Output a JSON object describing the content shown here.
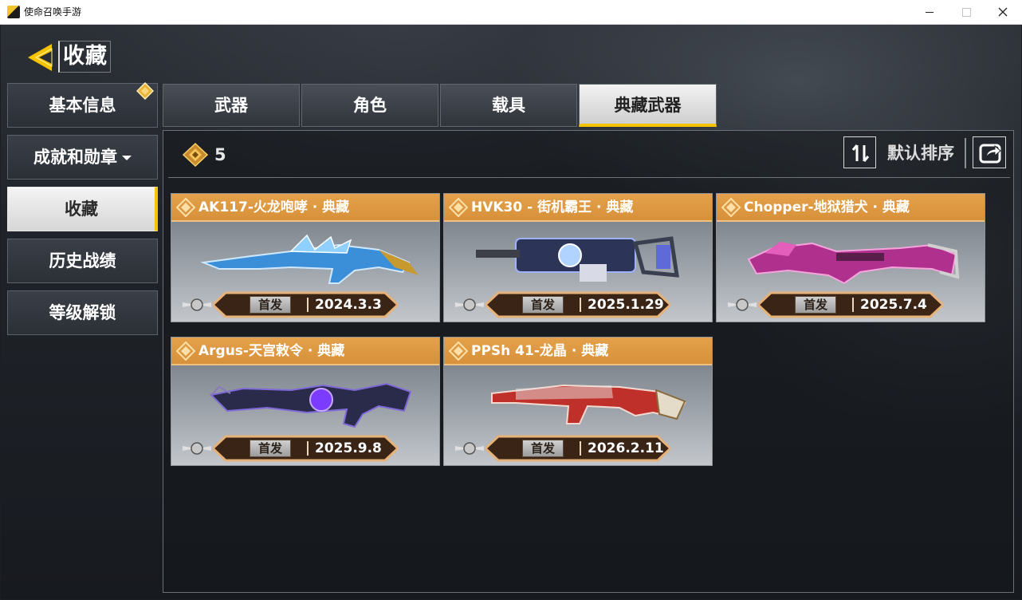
{
  "window": {
    "title": "使命召唤手游"
  },
  "header": {
    "title": "收藏"
  },
  "sidebar": {
    "items": [
      {
        "label": "基本信息"
      },
      {
        "label": "成就和勋章"
      },
      {
        "label": "收藏"
      },
      {
        "label": "历史战绩"
      },
      {
        "label": "等级解锁"
      }
    ]
  },
  "tabs": [
    {
      "label": "武器"
    },
    {
      "label": "角色"
    },
    {
      "label": "载具"
    },
    {
      "label": "典藏武器"
    }
  ],
  "toolbar": {
    "count": "5",
    "sort_label": "默认排序"
  },
  "cards": [
    {
      "name": "AK117-火龙咆哮 · 典藏",
      "tag": "首发",
      "date": "2024.3.3",
      "accent": "#4aa3e0"
    },
    {
      "name": "HVK30 - 街机霸王 · 典藏",
      "tag": "首发",
      "date": "2025.1.29",
      "accent": "#6a7fd6"
    },
    {
      "name": "Chopper-地狱猎犬 · 典藏",
      "tag": "首发",
      "date": "2025.7.4",
      "accent": "#d44aa8"
    },
    {
      "name": "Argus-天宫敕令 · 典藏",
      "tag": "首发",
      "date": "2025.9.8",
      "accent": "#6a3cc8"
    },
    {
      "name": "PPSh 41-龙晶 · 典藏",
      "tag": "首发",
      "date": "2026.2.11",
      "accent": "#c8322c"
    }
  ],
  "colors": {
    "accent": "#f5c400",
    "card_header": "#e09a44"
  }
}
